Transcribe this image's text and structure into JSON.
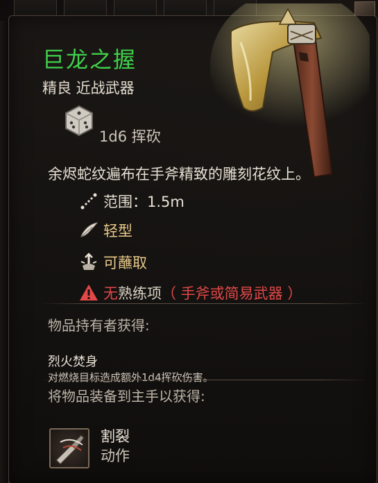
{
  "item": {
    "name": "巨龙之握",
    "type": "精良 近战武器",
    "damage": "1d6 挥砍",
    "description": "余烬蛇纹遍布在手斧精致的雕刻花纹上。"
  },
  "properties": {
    "range": "范围：1.5m",
    "light": "轻型",
    "dippable": "可蘸取",
    "proficiency_prefix": "无",
    "proficiency_mid": "熟练项",
    "proficiency_suffix": "（ 手斧或简易武器 ）"
  },
  "wielder": {
    "title": "物品持有者获得:",
    "passive_name": "烈火焚身",
    "passive_desc": "对燃烧目标造成额外1d4挥砍伤害。"
  },
  "equip": {
    "title": "将物品装备到主手以获得:",
    "action_name": "割裂",
    "action_kind": "动作"
  },
  "icons": {
    "die": "d6-die-icon",
    "range": "range-icon",
    "light": "feather-icon",
    "dip": "dip-icon",
    "warning": "warning-triangle-icon",
    "action": "rend-action-icon"
  },
  "colors": {
    "item_name": "#3fd04a",
    "property_gold": "#e8c98a",
    "warning_red": "#e24848"
  }
}
